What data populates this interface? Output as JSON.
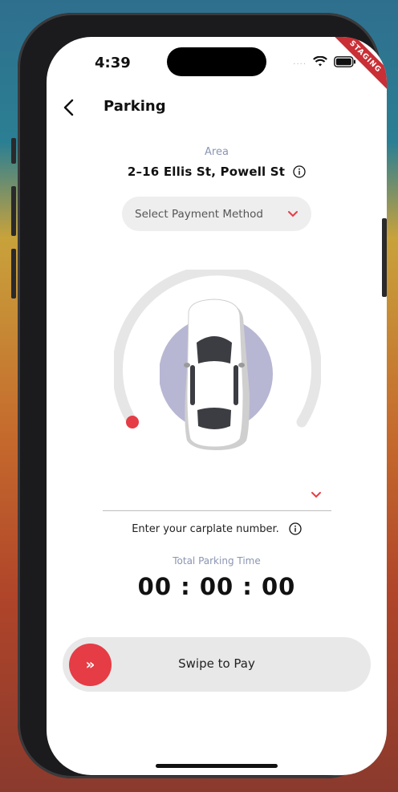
{
  "status": {
    "time": "4:39",
    "signal_dots": "....",
    "staging_ribbon": "STAGING"
  },
  "header": {
    "title": "Parking"
  },
  "area": {
    "label": "Area",
    "address": "2–16 Ellis St,  Powell St"
  },
  "payment": {
    "placeholder": "Select Payment Method"
  },
  "carplate": {
    "value": "",
    "hint": "Enter your carplate number."
  },
  "timer": {
    "label": "Total Parking Time",
    "value": "00 : 00 : 00"
  },
  "swipe": {
    "label": "Swipe to Pay",
    "knob_glyph": "»"
  },
  "colors": {
    "accent": "#e53c45",
    "muted_label": "#8b95b3",
    "gauge_track": "#e6e6e6",
    "car_halo": "#b7b6d3"
  },
  "icons": [
    "back-chevron-icon",
    "wifi-icon",
    "battery-icon",
    "info-icon",
    "chevron-down-icon",
    "double-chevron-right-icon"
  ]
}
